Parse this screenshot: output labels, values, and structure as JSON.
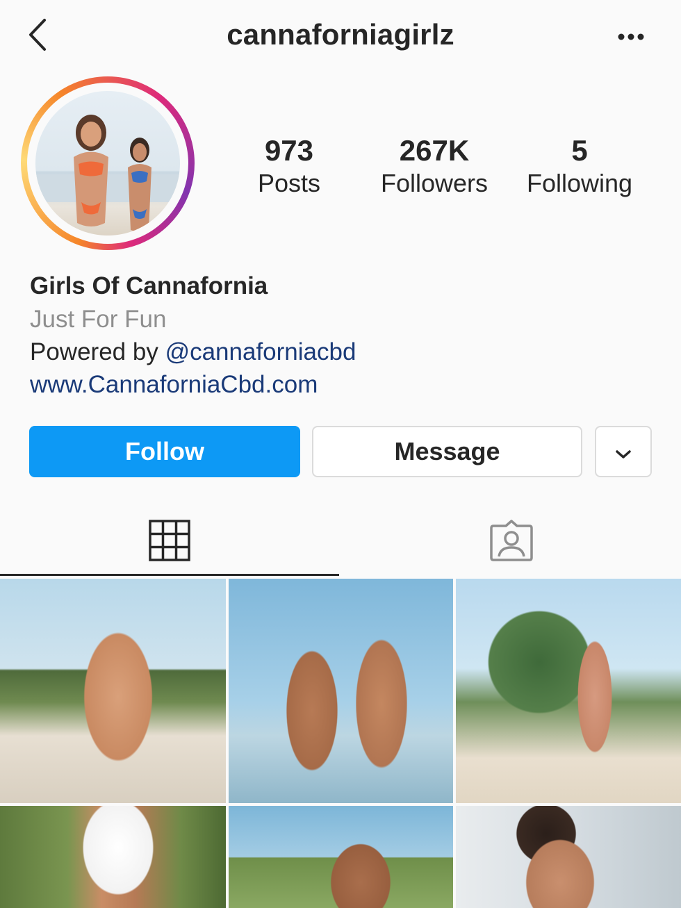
{
  "header": {
    "username": "cannaforniagirlz",
    "back_icon": "chevron-left-icon",
    "more_icon": "more-horizontal-icon"
  },
  "profile": {
    "avatar_icon": "profile-photo",
    "stats": [
      {
        "value": "973",
        "label": "Posts"
      },
      {
        "value": "267K",
        "label": "Followers"
      },
      {
        "value": "5",
        "label": "Following"
      }
    ]
  },
  "bio": {
    "name": "Girls Of Cannafornia",
    "category": "Just For Fun",
    "line_prefix": "Powered by ",
    "line_handle": "@cannaforniacbd",
    "url": "www.CannaforniaCbd.com"
  },
  "actions": {
    "follow_label": "Follow",
    "message_label": "Message",
    "dropdown_icon": "chevron-down-icon"
  },
  "colors": {
    "follow_blue": "#0d99f5",
    "link_blue": "#1a3a78",
    "secondary_text": "#8e8e8e"
  },
  "tabs": [
    {
      "name": "grid",
      "icon": "grid-icon",
      "selected": true
    },
    {
      "name": "tagged",
      "icon": "tagged-person-icon",
      "selected": false
    }
  ]
}
